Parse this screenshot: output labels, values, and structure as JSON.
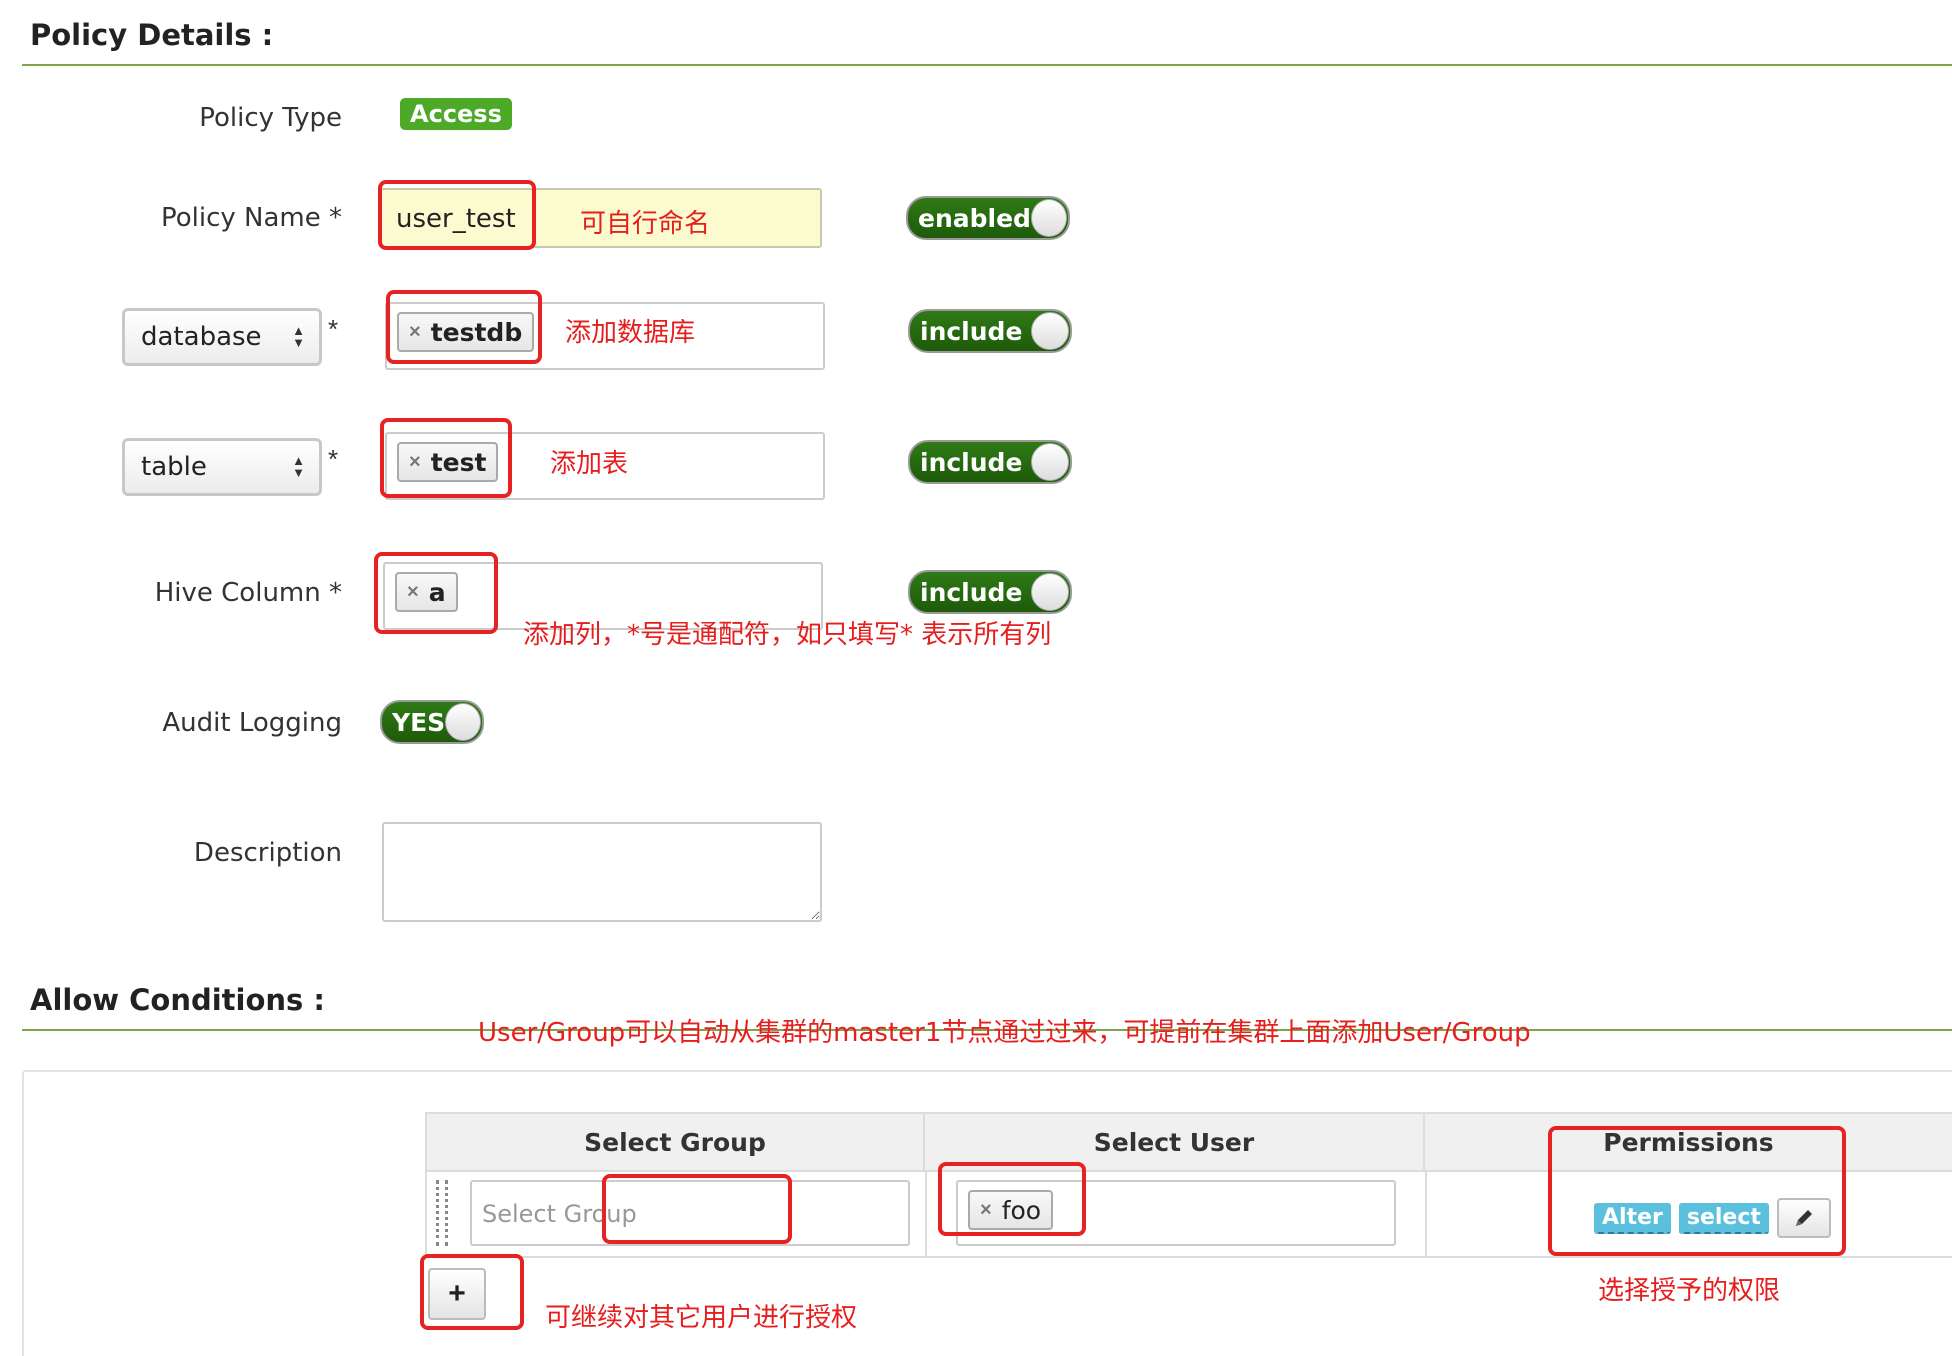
{
  "policy_details": {
    "title": "Policy Details :",
    "policy_type_label": "Policy Type",
    "policy_type_badge": "Access",
    "policy_name_label": "Policy Name *",
    "policy_name_value": "user_test",
    "policy_name_toggle": "enabled",
    "database_select": "database",
    "database_required": "*",
    "database_tag": "testdb",
    "database_toggle": "include",
    "table_select": "table",
    "table_required": "*",
    "table_tag": "test",
    "table_toggle": "include",
    "hive_column_label": "Hive Column *",
    "hive_column_tag": "a",
    "hive_column_toggle": "include",
    "audit_logging_label": "Audit Logging",
    "audit_logging_toggle": "YES",
    "description_label": "Description",
    "description_value": ""
  },
  "allow_conditions": {
    "title": "Allow Conditions :",
    "columns": [
      "Select Group",
      "Select User",
      "Permissions"
    ],
    "row": {
      "group_placeholder": "Select Group",
      "user_tag": "foo",
      "permissions": [
        "Alter",
        "select"
      ]
    },
    "add_button": "+"
  },
  "annotations": {
    "policy_name": "可自行命名",
    "database": "添加数据库",
    "table": "添加表",
    "column": "添加列，*号是通配符，如只填写* 表示所有列",
    "user_group": "User/Group可以自动从集群的master1节点通过过来，可提前在集群上面添加User/Group",
    "permissions": "选择授予的权限",
    "add_more": "可继续对其它用户进行授权"
  },
  "colors": {
    "section_line": "#7ea54a",
    "toggle_green": "#2f7a16",
    "badge_green": "#4caa28",
    "annotation_red": "#e62222",
    "permission_tag": "#5bc0de"
  }
}
